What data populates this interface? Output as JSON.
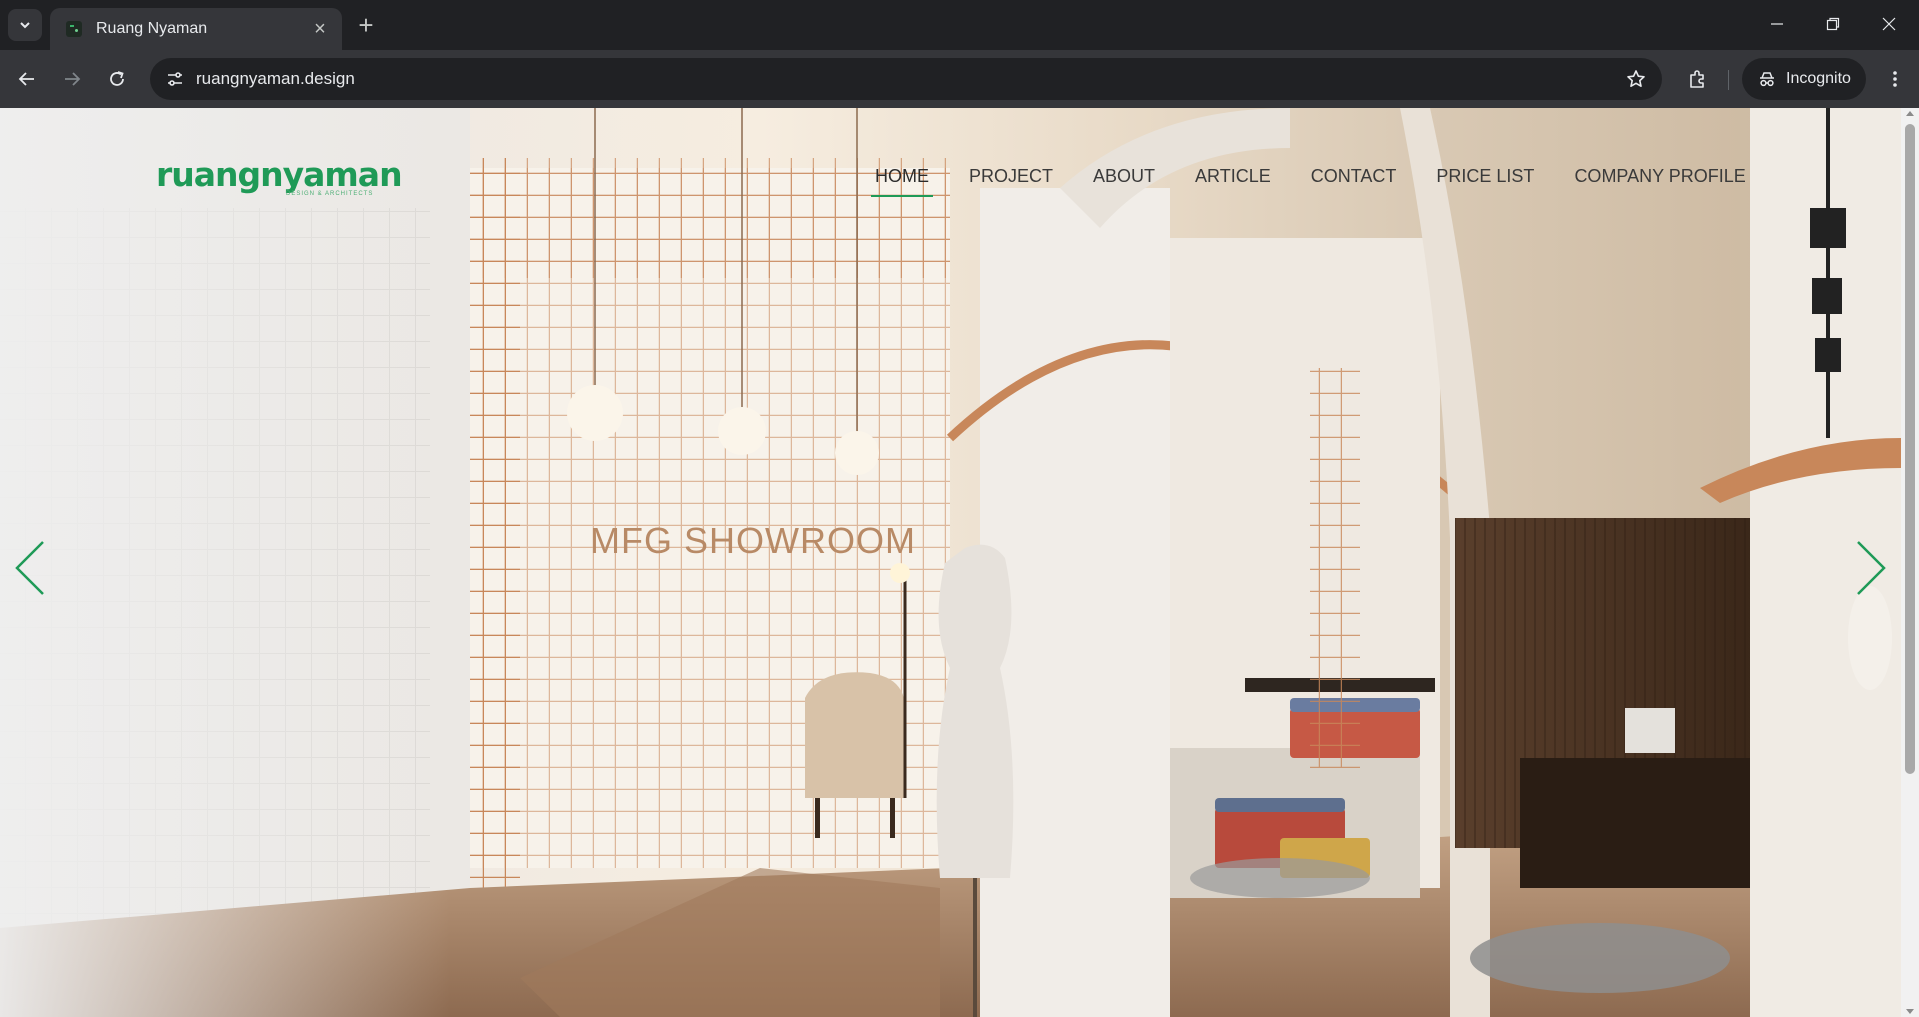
{
  "browser": {
    "tab_title": "Ruang Nyaman",
    "url": "ruangnyaman.design",
    "incognito_label": "Incognito"
  },
  "site": {
    "logo_text": "ruangnyaman",
    "logo_tagline": "DESIGN & ARCHITECTS",
    "nav": [
      {
        "label": "HOME",
        "active": true
      },
      {
        "label": "PROJECT"
      },
      {
        "label": "ABOUT"
      },
      {
        "label": "ARTICLE"
      },
      {
        "label": "CONTACT"
      },
      {
        "label": "PRICE LIST"
      },
      {
        "label": "COMPANY PROFILE"
      }
    ],
    "slide_sign_text": "MFG SHOWROOM",
    "accent_color": "#1f9a57"
  }
}
